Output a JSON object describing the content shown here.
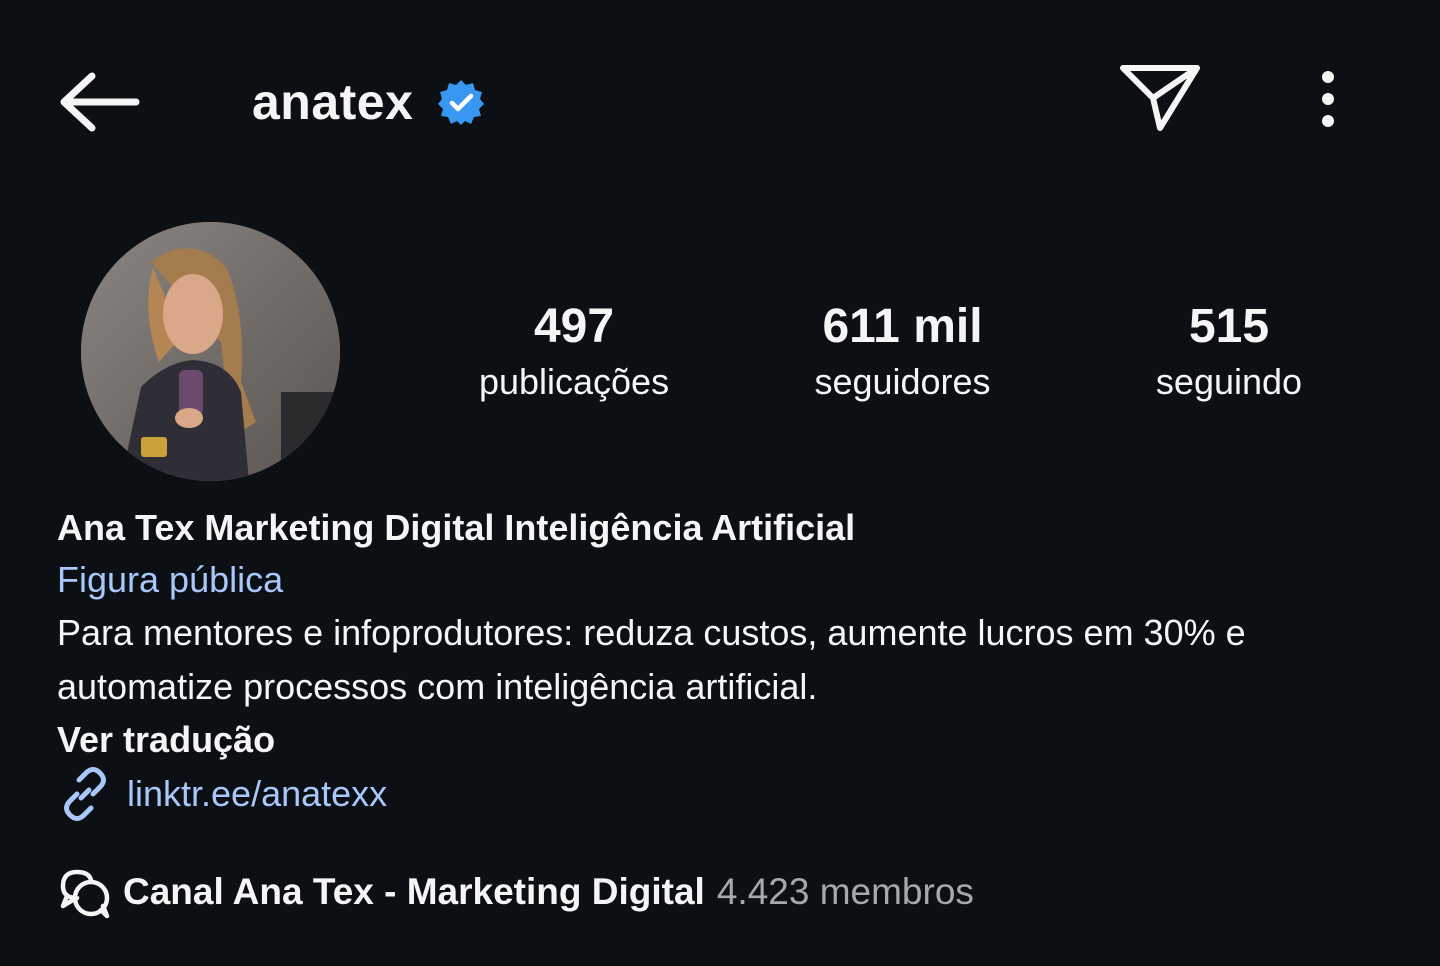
{
  "header": {
    "username": "anatex",
    "verified": true,
    "icons": {
      "back": "back-arrow-icon",
      "send": "send-message-icon",
      "more": "more-options-icon",
      "verified": "verified-badge-icon"
    },
    "verified_color": "#3897f0"
  },
  "stats": {
    "posts": {
      "value": "497",
      "label": "publicações"
    },
    "followers": {
      "value": "611 mil",
      "label": "seguidores"
    },
    "following": {
      "value": "515",
      "label": "seguindo"
    }
  },
  "profile": {
    "full_name": "Ana Tex Marketing Digital Inteligência Artificial",
    "category": "Figura pública",
    "bio": "Para mentores e infoprodutores: reduza custos, aumente lucros em 30% e automatize processos com inteligência artificial.",
    "translate_label": "Ver tradução",
    "link": "linktr.ee/anatexx",
    "link_color": "#a8c7fa"
  },
  "channel": {
    "name": "Canal Ana Tex -  Marketing Digital",
    "members": "4.423 membros",
    "icon": "broadcast-channel-icon"
  },
  "colors": {
    "background": "#0c1014",
    "text": "#f5f5f5",
    "secondary_text": "#a8a8a8"
  }
}
